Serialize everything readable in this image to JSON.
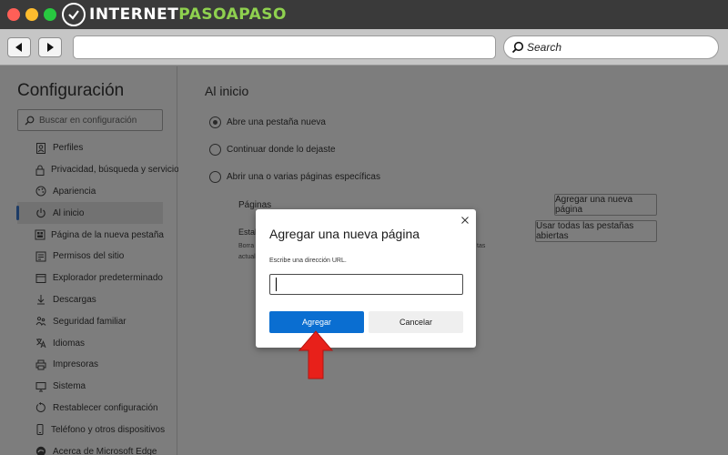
{
  "window": {
    "brand_logo": "INTERNETPASOAPASO",
    "brand_part1": "INTERNET",
    "brand_part2": "PASOAPASO"
  },
  "toolbar": {
    "back_icon": "back-arrow-icon",
    "forward_icon": "forward-arrow-icon",
    "url_value": "",
    "search_label": "Search"
  },
  "sidebar": {
    "title": "Configuración",
    "search_placeholder": "Buscar en configuración",
    "items": [
      {
        "label": "Perfiles",
        "icon": "profile-icon"
      },
      {
        "label": "Privacidad, búsqueda y servicios",
        "icon": "lock-icon"
      },
      {
        "label": "Apariencia",
        "icon": "palette-icon"
      },
      {
        "label": "Al inicio",
        "icon": "power-icon",
        "active": true
      },
      {
        "label": "Página de la nueva pestaña",
        "icon": "new-tab-page-icon"
      },
      {
        "label": "Permisos del sitio",
        "icon": "site-permissions-icon"
      },
      {
        "label": "Explorador predeterminado",
        "icon": "browser-icon"
      },
      {
        "label": "Descargas",
        "icon": "download-icon"
      },
      {
        "label": "Seguridad familiar",
        "icon": "family-icon"
      },
      {
        "label": "Idiomas",
        "icon": "language-icon"
      },
      {
        "label": "Impresoras",
        "icon": "printer-icon"
      },
      {
        "label": "Sistema",
        "icon": "system-icon"
      },
      {
        "label": "Restablecer configuración",
        "icon": "reset-icon"
      },
      {
        "label": "Teléfono y otros dispositivos",
        "icon": "phone-icon"
      },
      {
        "label": "Acerca de Microsoft Edge",
        "icon": "edge-icon"
      }
    ]
  },
  "main": {
    "section_title": "Al inicio",
    "options": [
      {
        "label": "Abre una pestaña nueva",
        "checked": true
      },
      {
        "label": "Continuar donde lo dejaste",
        "checked": false
      },
      {
        "label": "Abrir una o varias páginas específicas",
        "checked": false
      }
    ],
    "pages_label": "Páginas",
    "add_page_button": "Agregar una nueva página",
    "estab_fragment": "Estab",
    "borra_fragment": "Borra",
    "actual_fragment": "actual",
    "tas_fragment": "tas",
    "use_all_tabs_button": "Usar todas las pestañas abiertas"
  },
  "dialog": {
    "title": "Agregar una nueva página",
    "url_label": "Escribe una dirección URL.",
    "url_value": "",
    "primary_button": "Agregar",
    "secondary_button": "Cancelar"
  },
  "colors": {
    "primary_button": "#0a6ed1",
    "annotation_arrow": "#e8201a",
    "overlay": "#7d7d7d"
  }
}
